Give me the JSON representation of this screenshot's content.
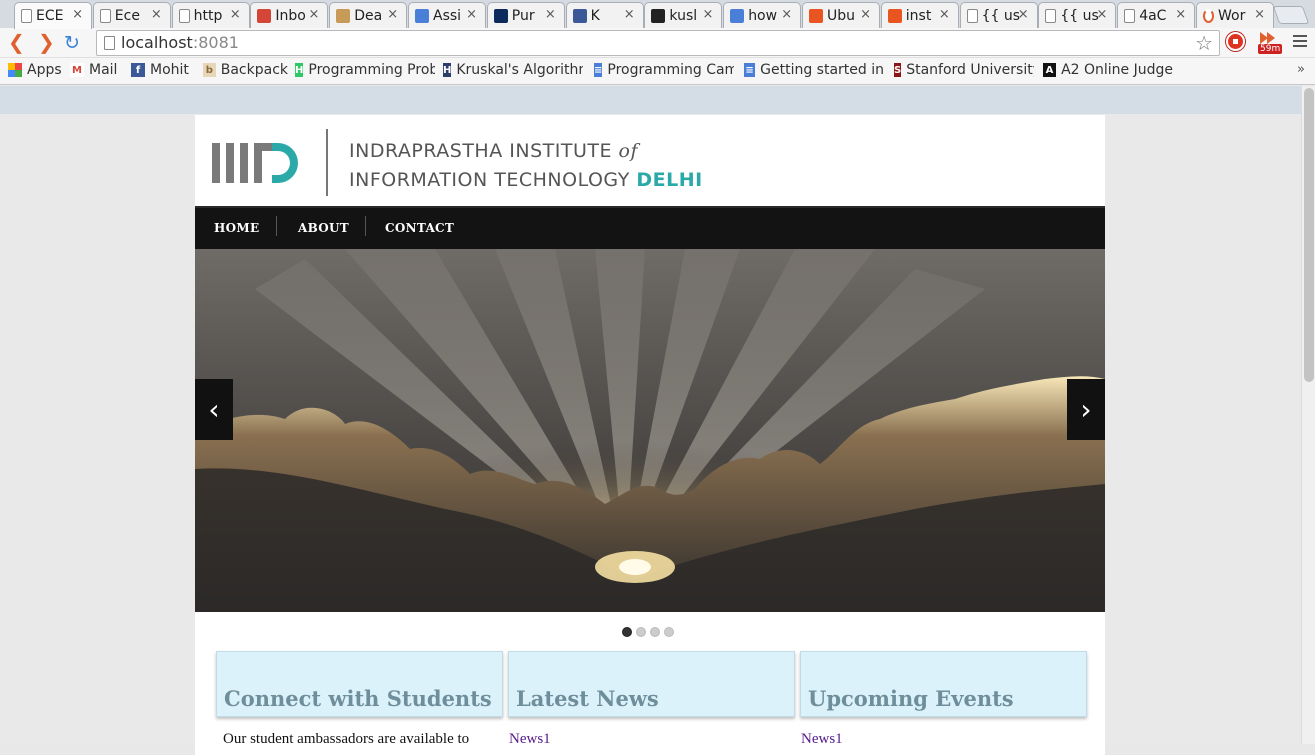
{
  "browser": {
    "tabs": [
      {
        "title": "ECE",
        "favicon": "page-icon",
        "active": true
      },
      {
        "title": "Ece",
        "favicon": "page-icon"
      },
      {
        "title": "http",
        "favicon": "page-icon"
      },
      {
        "title": "Inbo",
        "favicon": "gmail-icon"
      },
      {
        "title": "Dea",
        "favicon": "backpack-icon"
      },
      {
        "title": "Assi",
        "favicon": "docs-icon"
      },
      {
        "title": "Pur",
        "favicon": "ubc-icon"
      },
      {
        "title": "K",
        "favicon": "facebook-icon"
      },
      {
        "title": "kusl",
        "favicon": "github-icon"
      },
      {
        "title": "how",
        "favicon": "google-icon"
      },
      {
        "title": "Ubu",
        "favicon": "ubuntu-icon"
      },
      {
        "title": "inst",
        "favicon": "askubuntu-icon"
      },
      {
        "title": "{{ us",
        "favicon": "page-icon"
      },
      {
        "title": "{{ us",
        "favicon": "page-icon"
      },
      {
        "title": "4aC",
        "favicon": "page-icon"
      },
      {
        "title": "Wor",
        "favicon": "loading-icon"
      }
    ],
    "url_host": "localhost",
    "url_port": ":8081",
    "extension_badge": "59m",
    "bookmarks": [
      {
        "label": "Apps",
        "icon": "apps-grid-icon"
      },
      {
        "label": "Mail",
        "icon": "gmail-icon"
      },
      {
        "label": "Mohit",
        "icon": "facebook-icon"
      },
      {
        "label": "Backpack",
        "icon": "backpack-icon"
      },
      {
        "label": "Programming Prob",
        "icon": "hackerrank-icon"
      },
      {
        "label": "Kruskal's Algorithn",
        "icon": "hackerearth-icon"
      },
      {
        "label": "Programming Cam",
        "icon": "docs-icon"
      },
      {
        "label": "Getting started in",
        "icon": "docs-icon"
      },
      {
        "label": "Stanford University",
        "icon": "stanford-icon"
      },
      {
        "label": "A2 Online Judge",
        "icon": "a2-icon"
      }
    ],
    "bookmarks_more": "»"
  },
  "site": {
    "logo_line1": "INDRAPRASTHA INSTITUTE ",
    "logo_of": "of",
    "logo_line2": "INFORMATION TECHNOLOGY ",
    "logo_delhi": "DELHI",
    "nav": [
      "HOME",
      "ABOUT",
      "CONTACT"
    ],
    "slider_prev": "‹",
    "slider_next": "›",
    "slider_active_index": 0,
    "slider_count": 4,
    "boxes": [
      {
        "heading": "Connect with Students",
        "below": "Our student ambassadors are available to",
        "below_is_link": false
      },
      {
        "heading": "Latest News",
        "below": "News1",
        "below_is_link": true
      },
      {
        "heading": "Upcoming Events",
        "below": "News1",
        "below_is_link": true
      }
    ]
  },
  "colors": {
    "accent_teal": "#2aa9a8",
    "nav_bg": "#131313",
    "box_bg": "#dcf2fb",
    "box_heading": "#6d8e9a"
  }
}
